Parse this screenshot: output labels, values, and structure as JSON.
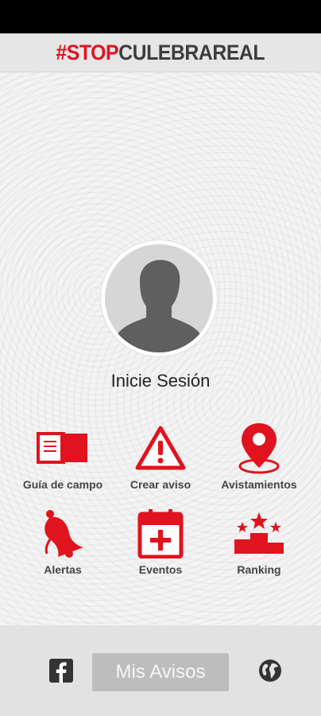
{
  "header": {
    "brand_hash_stop": "#STOP",
    "brand_rest": "CULEBRAREAL"
  },
  "profile": {
    "login_label": "Inicie Sesión"
  },
  "menu": [
    {
      "label": "Guía de campo",
      "icon": "book-icon"
    },
    {
      "label": "Crear aviso",
      "icon": "warning-icon"
    },
    {
      "label": "Avistamientos",
      "icon": "map-pin-icon"
    },
    {
      "label": "Alertas",
      "icon": "bell-icon"
    },
    {
      "label": "Eventos",
      "icon": "calendar-add-icon"
    },
    {
      "label": "Ranking",
      "icon": "podium-icon"
    }
  ],
  "bottom": {
    "mis_avisos_label": "Mis Avisos",
    "facebook_icon": "facebook-icon",
    "globe_icon": "globe-icon"
  },
  "colors": {
    "accent": "#e0131f",
    "dark": "#3d3d3d",
    "button_bg": "#bdbdbd"
  }
}
